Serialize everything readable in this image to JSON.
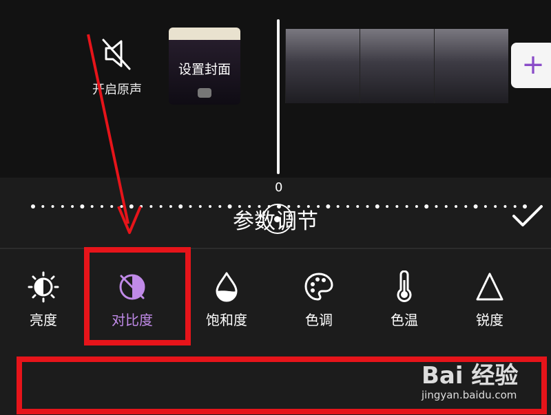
{
  "timeline": {
    "mute_label": "开启原声",
    "cover_label": "设置封面",
    "add_label": "+"
  },
  "panel": {
    "title": "参数调节",
    "tools": [
      {
        "label": "亮度",
        "icon": "brightness-icon",
        "active": false
      },
      {
        "label": "对比度",
        "icon": "contrast-icon",
        "active": true
      },
      {
        "label": "饱和度",
        "icon": "saturation-icon",
        "active": false
      },
      {
        "label": "色调",
        "icon": "palette-icon",
        "active": false
      },
      {
        "label": "色温",
        "icon": "thermometer-icon",
        "active": false
      },
      {
        "label": "锐度",
        "icon": "sharpness-icon",
        "active": false
      }
    ],
    "slider_value": "0",
    "accent_color": "#c08ae8"
  },
  "annotations": {
    "highlight_color": "#e6141a"
  },
  "watermark": {
    "brand": "Bai 经验",
    "url": "jingyan.baidu.com"
  }
}
